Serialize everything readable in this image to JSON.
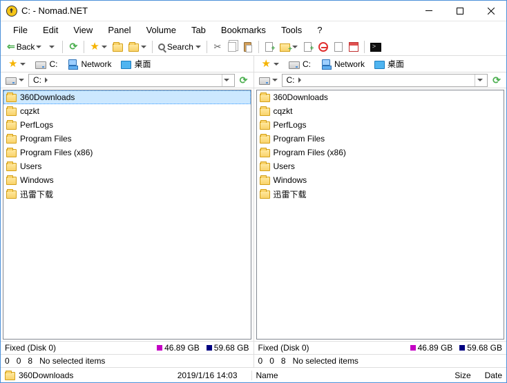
{
  "title": "C: - Nomad.NET",
  "menu": [
    "File",
    "Edit",
    "View",
    "Panel",
    "Volume",
    "Tab",
    "Bookmarks",
    "Tools",
    "?"
  ],
  "toolbar": {
    "back": "Back",
    "search": "Search"
  },
  "drives": {
    "c": "C:",
    "network": "Network",
    "desktop": "桌面"
  },
  "path": {
    "segment": "C:"
  },
  "leftFiles": [
    "360Downloads",
    "cqzkt",
    "PerfLogs",
    "Program Files",
    "Program Files (x86)",
    "Users",
    "Windows",
    "迅雷下载"
  ],
  "rightFiles": [
    "360Downloads",
    "cqzkt",
    "PerfLogs",
    "Program Files",
    "Program Files (x86)",
    "Users",
    "Windows",
    "迅雷下载"
  ],
  "disk": {
    "label": "Fixed (Disk 0)",
    "free": "46.89 GB",
    "total": "59.68 GB"
  },
  "selection": {
    "a": "0",
    "b": "0",
    "c": "8",
    "text": "No selected items"
  },
  "bottom": {
    "name": "360Downloads",
    "date": "2019/1/16 14:03",
    "headers": {
      "name": "Name",
      "size": "Size",
      "date": "Date"
    }
  }
}
